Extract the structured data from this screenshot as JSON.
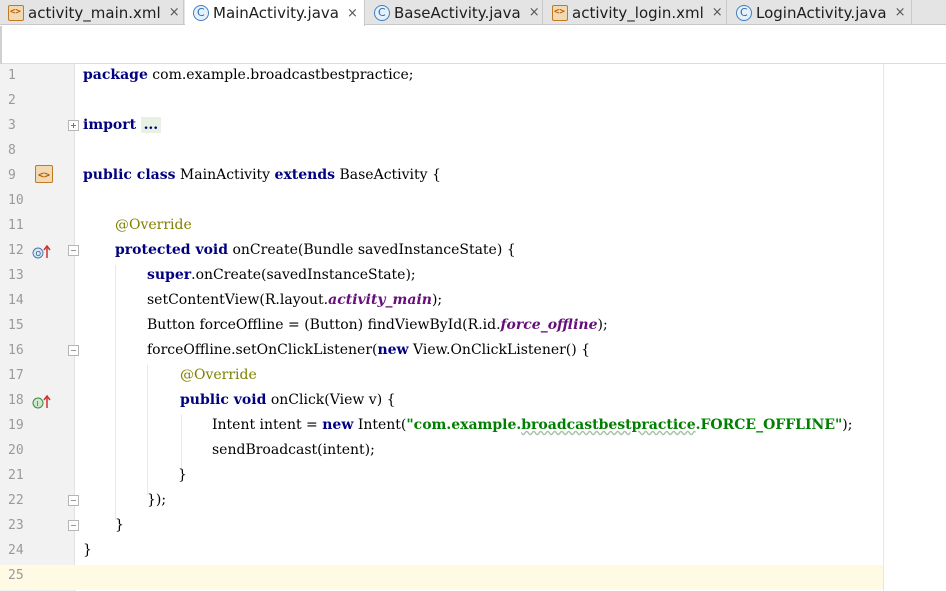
{
  "tabs": [
    {
      "label": "activity_main.xml",
      "icon": "xml-layout-icon",
      "active": false
    },
    {
      "label": "MainActivity.java",
      "icon": "java-class-icon",
      "active": true
    },
    {
      "label": "BaseActivity.java",
      "icon": "java-class-icon",
      "active": false
    },
    {
      "label": "activity_login.xml",
      "icon": "xml-layout-icon",
      "active": false
    },
    {
      "label": "LoginActivity.java",
      "icon": "java-class-icon",
      "active": false
    }
  ],
  "close_glyph": "×",
  "line_numbers": [
    "1",
    "2",
    "3",
    "8",
    "9",
    "10",
    "11",
    "12",
    "13",
    "14",
    "15",
    "16",
    "17",
    "18",
    "19",
    "20",
    "21",
    "22",
    "23",
    "24",
    "25"
  ],
  "code": {
    "l1_kw": "package",
    "l1_rest": " com.example.broadcastbestpractice;",
    "l3_kw": "import",
    "l3_folded": "...",
    "l9_kw1": "public class",
    "l9_name": " MainActivity ",
    "l9_kw2": "extends",
    "l9_rest": " BaseActivity {",
    "l11_ann": "@Override",
    "l12_kw": "protected void",
    "l12_rest": " onCreate(Bundle savedInstanceState) {",
    "l13_kw": "super",
    "l13_rest": ".onCreate(savedInstanceState);",
    "l14_pre": "setContentView(R.layout.",
    "l14_fld": "activity_main",
    "l14_post": ");",
    "l15_pre": "Button forceOffline = (Button) findViewById(R.id.",
    "l15_fld": "force_offline",
    "l15_post": ");",
    "l16_pre": "forceOffline.setOnClickListener(",
    "l16_kw": "new",
    "l16_post": " View.OnClickListener() {",
    "l17_ann": "@Override",
    "l18_kw": "public void",
    "l18_rest": " onClick(View v) {",
    "l19_pre": "Intent intent = ",
    "l19_kw": "new",
    "l19_mid": " Intent(",
    "l19_str_a": "\"com.example.",
    "l19_str_b": "broadcastbestpractice",
    "l19_str_c": ".FORCE_OFFLINE\"",
    "l19_post": ");",
    "l20": "sendBroadcast(intent);",
    "l21": "}",
    "l22": "});",
    "l23": "}",
    "l24": "}"
  }
}
